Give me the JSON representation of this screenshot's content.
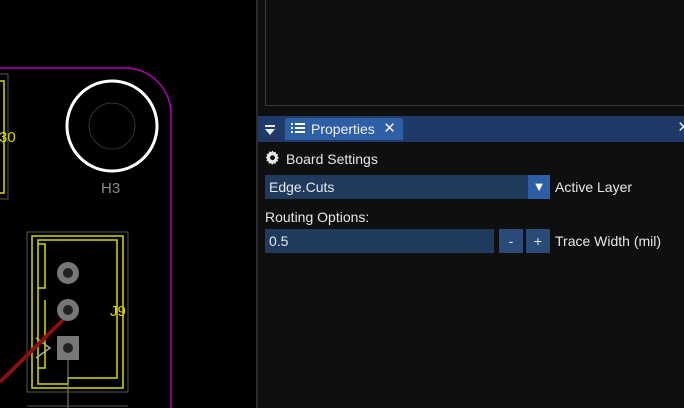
{
  "canvas": {
    "labels": {
      "ref_partial": "30",
      "h3": "H3",
      "j9": "J9"
    },
    "colors": {
      "board_edge": "#b300b3",
      "silkscreen": "#d8d800",
      "copper": "#8a1010"
    }
  },
  "tabbar": {
    "menu_icon": "dropdown-menu-icon",
    "tab_label": "Properties",
    "tab_icon": "list-icon",
    "close_icon": "close-icon"
  },
  "properties": {
    "section_title": "Board Settings",
    "section_icon": "gear-icon",
    "active_layer": {
      "value": "Edge.Cuts",
      "label": "Active Layer"
    },
    "routing": {
      "title": "Routing Options:",
      "trace_width_value": "0.5",
      "minus": "-",
      "plus": "+",
      "trace_width_label": "Trace Width (mil)"
    }
  },
  "colors": {
    "accent": "#2e5ea6",
    "tabbar_bg": "#1f3a66",
    "field_bg": "#203a5e",
    "panel_bg": "#0f0f10"
  }
}
